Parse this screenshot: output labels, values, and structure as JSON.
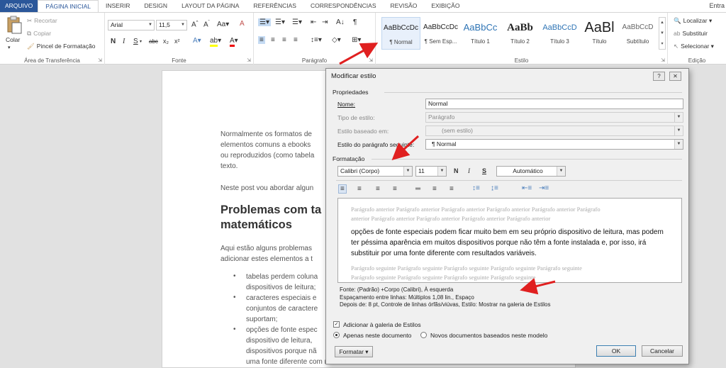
{
  "tabs": {
    "file": "ARQUIVO",
    "items": [
      "PÁGINA INICIAL",
      "INSERIR",
      "DESIGN",
      "LAYOUT DA PÁGINA",
      "REFERÊNCIAS",
      "CORRESPONDÊNCIAS",
      "REVISÃO",
      "EXIBIÇÃO"
    ],
    "right": "Entra"
  },
  "clipboard": {
    "paste": "Colar",
    "cut": "Recortar",
    "copy": "Copiar",
    "format_painter": "Pincel de Formatação",
    "group_label": "Área de Transferência"
  },
  "font_group": {
    "font_name": "Arial",
    "font_size": "11,5",
    "group_label": "Fonte",
    "bold": "N",
    "italic": "I",
    "underline": "S",
    "strike": "abc",
    "sub": "x₂",
    "sup": "x²"
  },
  "paragraph_group": {
    "group_label": "Parágrafo",
    "pilcrow": "¶"
  },
  "styles_group": {
    "group_label": "Estilo",
    "items": [
      {
        "preview": "AaBbCcDc",
        "name": "¶ Normal"
      },
      {
        "preview": "AaBbCcDc",
        "name": "¶ Sem Esp..."
      },
      {
        "preview": "AaBbCc",
        "name": "Título 1"
      },
      {
        "preview": "AaBb",
        "name": "Título 2"
      },
      {
        "preview": "AaBbCcD",
        "name": "Título 3"
      },
      {
        "preview": "AaBl",
        "name": "Título"
      },
      {
        "preview": "AaBbCcD",
        "name": "Subtítulo"
      }
    ]
  },
  "editing_group": {
    "group_label": "Edição",
    "find": "Localizar",
    "replace": "Substituir",
    "select": "Selecionar"
  },
  "document": {
    "para1": [
      "Normalmente os formatos de",
      "elementos comuns a ebooks",
      "ou reproduzidos (como tabela",
      "texto."
    ],
    "para2": "Neste post vou abordar algun",
    "heading": [
      "Problemas com ta",
      "matemáticos"
    ],
    "para3": [
      "Aqui estão alguns problemas",
      "adicionar estes elementos a t"
    ],
    "bullets": [
      [
        "tabelas perdem coluna",
        "dispositivos de leitura;"
      ],
      [
        "caracteres especiais e",
        "conjuntos de caractere",
        "suportam;"
      ],
      [
        "opções de fonte espec",
        "dispositivo de leitura,",
        "dispositivos porque nã",
        "uma fonte diferente com resultados variáveis."
      ]
    ]
  },
  "dialog": {
    "title": "Modificar estilo",
    "help": "?",
    "close": "✕",
    "properties_title": "Propriedades",
    "name_label": "Nome:",
    "name_value": "Normal",
    "type_label": "Tipo de estilo:",
    "type_value": "Parágrafo",
    "based_label": "Estilo baseado em:",
    "based_value": "(sem estilo)",
    "next_label": "Estilo do parágrafo seguinte:",
    "next_value": "¶  Normal",
    "format_title": "Formatação",
    "font": "Calibri (Corpo)",
    "size": "11",
    "bold": "N",
    "italic": "I",
    "underline": "S",
    "color": "Automático",
    "preview_prev": [
      "Parágrafo anterior Parágrafo anterior Parágrafo anterior Parágrafo anterior Parágrafo anterior Parágrafo",
      "anterior Parágrafo anterior Parágrafo anterior Parágrafo anterior Parágrafo anterior"
    ],
    "preview_main": [
      "opções de fonte especiais podem ficar muito bem em seu próprio dispositivo de leitura, mas podem",
      "ter péssima aparência em muitos dispositivos porque não têm a fonte instalada e, por isso, irá",
      "substituir por uma fonte diferente com resultados variáveis."
    ],
    "preview_next": [
      "Parágrafo seguinte Parágrafo seguinte Parágrafo seguinte Parágrafo seguinte Parágrafo seguinte",
      "Parágrafo seguinte Parágrafo seguinte Parágrafo seguinte Parágrafo seguinte"
    ],
    "description": [
      "Fonte: (Padrão) +Corpo (Calibri), À esquerda",
      "    Espaçamento entre linhas:  Múltiplos 1,08 lin., Espaço",
      "    Depois de:  8 pt, Controle de linhas órfãs/viúvas, Estilo: Mostrar na galeria de Estilos"
    ],
    "add_gallery": "Adicionar à galeria de Estilos",
    "only_doc": "Apenas neste documento",
    "new_docs": "Novos documentos baseados neste modelo",
    "format_btn": "Formatar ▾",
    "ok": "OK",
    "cancel": "Cancelar"
  }
}
